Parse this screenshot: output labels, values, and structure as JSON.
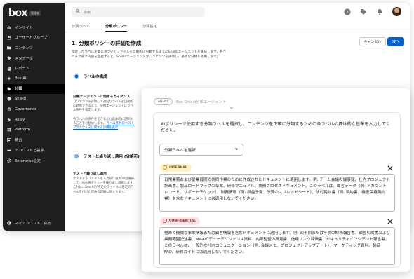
{
  "app": {
    "logo": "box",
    "logo_badge": "管理者"
  },
  "sidebar": {
    "items": [
      {
        "label": "インサイト",
        "icon": "chart-icon"
      },
      {
        "label": "ユーザーとグループ",
        "icon": "users-icon"
      },
      {
        "label": "コンテンツ",
        "icon": "folder-icon"
      },
      {
        "label": "メタデータ",
        "icon": "tag-icon"
      },
      {
        "label": "レポート",
        "icon": "report-icon"
      },
      {
        "label": "Box AI",
        "icon": "ai-icon"
      },
      {
        "label": "分類",
        "icon": "classification-icon",
        "active": true
      },
      {
        "label": "Shield",
        "icon": "shield-icon"
      },
      {
        "label": "Governance",
        "icon": "governance-icon"
      },
      {
        "label": "Relay",
        "icon": "relay-icon"
      },
      {
        "label": "Platform",
        "icon": "platform-icon"
      },
      {
        "label": "統合",
        "icon": "integrations-icon"
      },
      {
        "label": "アカウントと請求",
        "icon": "billing-icon"
      },
      {
        "label": "Enterprise設定",
        "icon": "settings-icon"
      }
    ],
    "bottom": {
      "label": "マイアカウントに戻る",
      "icon": "back-icon"
    }
  },
  "topbar": {
    "search_placeholder": "検索"
  },
  "tabs": [
    {
      "label": "分類ラベル"
    },
    {
      "label": "分類ポリシー",
      "active": true
    },
    {
      "label": "分類設定"
    }
  ],
  "page": {
    "title": "1. 分類ポリシーの詳細を作成",
    "cancel_label": "キャンセル",
    "next_label": "次へ",
    "description": "指定したラベル定義に基づいてファイルを自動的に分類するようにShieldエージェントを構成します。各ラベルが表す内容を定義すると、Shieldエージェントがコンテンツを評価し、最適な分類を適用します。",
    "section1_title": "ラベルの構成",
    "block1_heading": "分類エージェントに関するガイダンス",
    "block1_text": "コンテンツを評価して適切なラベルを自動的に適用できるよう、分類エージェントにラベル条件を指定します。",
    "block1_text2": "各ラベルの条件をできるだけ具体的に説明することをお勧めします。",
    "block1_link": "ラベル条件のベストプラクティスに関する詳細を表示",
    "section2_title": "テストと繰り返し適用 (省略可)",
    "block2_heading": "テストと繰り返し適用",
    "block2_text": "テストするファイルを入力前に最大10個選択して、AI分類ポリシーを繰り返し適用します。これは、Box AIが特定のファイルに特定のラベルを付けた理由の理解に役立ちます。"
  },
  "overlay": {
    "agent_badge": "AGENT",
    "agent_name": "Box Shield分類エージェント",
    "instruction": "AIポリシーで使用する分類ラベルを選択し、コンテンツを正確に分類するために各ラベルの具体的な基準を入力してください。",
    "select_label": "分類ラベルを選択",
    "labels": [
      {
        "name": "INTERNAL",
        "color": "#fff2c7",
        "text": "日常業務および従業員間の共同作業のために作成されたドキュメントに適用します。例: チーム会議の議事録、社内プロジェクト計画書、製品ロードマップの草案、研修マニュアル、業務プロセスドキュメント。このラベルは、顧客データ（例: アカウントレコード、サポートチケット）、財務情報（例: 収益予測、予算のスプレッドシート）、法的契約書（例: 契約書、機密保持契約書）を含むドキュメントには適用しないでください。"
      },
      {
        "name": "CONFIDENTIAL",
        "color": "#fde3e3",
        "text": "極めて機微な事業情報または顧客情報を含むドキュメントに適用します。例: 四半期または年次の財務報告書、顧客契約書および業務範囲記述書、M&Aのデューデリジェンス資料、内部監査の所見書、信用リスク評価書、セキュリティインシデント報告書。このラベルは、一般的な社内コミュニケーション（例: 会議メモ、プロジェクトアップデート）、マーケティング資料、製品FAQ、研修ガイドには適用しないでください。"
      }
    ]
  }
}
